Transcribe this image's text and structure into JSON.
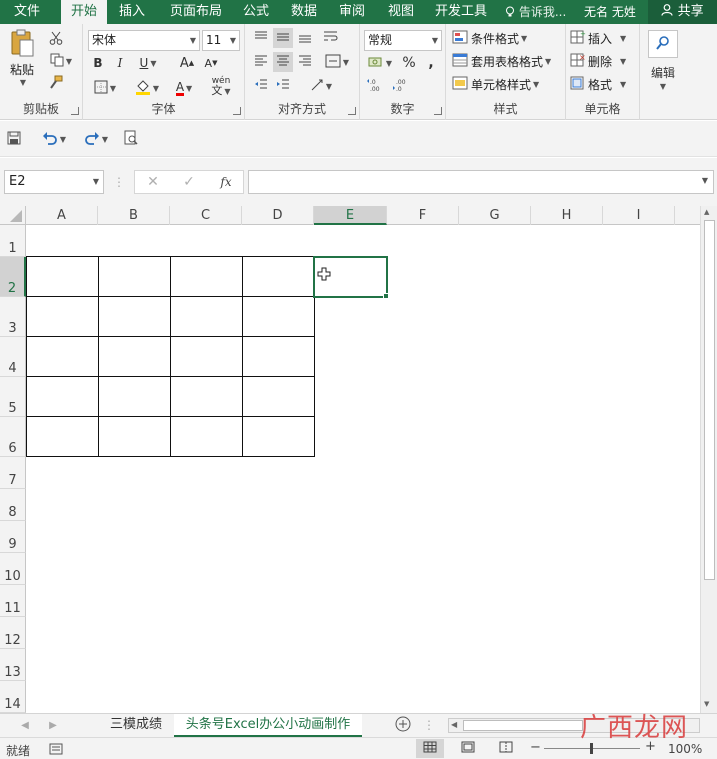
{
  "menu": {
    "tabs": [
      "文件",
      "开始",
      "插入",
      "页面布局",
      "公式",
      "数据",
      "审阅",
      "视图",
      "开发工具"
    ],
    "active": "开始",
    "tell_me": "告诉我...",
    "user": "无名 无姓",
    "share": "共享"
  },
  "ribbon": {
    "clipboard": {
      "label": "剪贴板",
      "paste": "粘贴"
    },
    "font": {
      "label": "字体",
      "name": "宋体",
      "size": "11",
      "bold": "B",
      "italic": "I",
      "underline": "U",
      "grow": "A",
      "shrink": "A",
      "color_a": "A",
      "wen": "wén"
    },
    "alignment": {
      "label": "对齐方式"
    },
    "number": {
      "label": "数字",
      "format": "常规",
      "percent": "%",
      "comma": ","
    },
    "styles": {
      "label": "样式",
      "conditional": "条件格式",
      "table": "套用表格格式",
      "cell_styles": "单元格样式"
    },
    "cells": {
      "label": "单元格",
      "insert": "插入",
      "delete": "删除",
      "format": "格式"
    },
    "editing": {
      "label": "编辑"
    }
  },
  "formula_bar": {
    "name_box": "E2",
    "fx": "fx",
    "content": ""
  },
  "sheet": {
    "columns": [
      "A",
      "B",
      "C",
      "D",
      "E",
      "F",
      "G",
      "H",
      "I"
    ],
    "selected_column": "E",
    "rows": [
      "1",
      "2",
      "3",
      "4",
      "5",
      "6",
      "7",
      "8",
      "9",
      "10",
      "11",
      "12",
      "13",
      "14"
    ],
    "selected_row": "2",
    "active_cell": "E2"
  },
  "tabs": {
    "sheets": [
      "三模成绩",
      "头条号Excel办公小动画制作"
    ],
    "active": "头条号Excel办公小动画制作"
  },
  "status": {
    "ready": "就绪",
    "zoom": "100%",
    "minus": "−",
    "plus": "+"
  },
  "watermark": "广西龙网",
  "colors": {
    "accent": "#217346",
    "ribbon_bg": "#f3f3f3"
  }
}
